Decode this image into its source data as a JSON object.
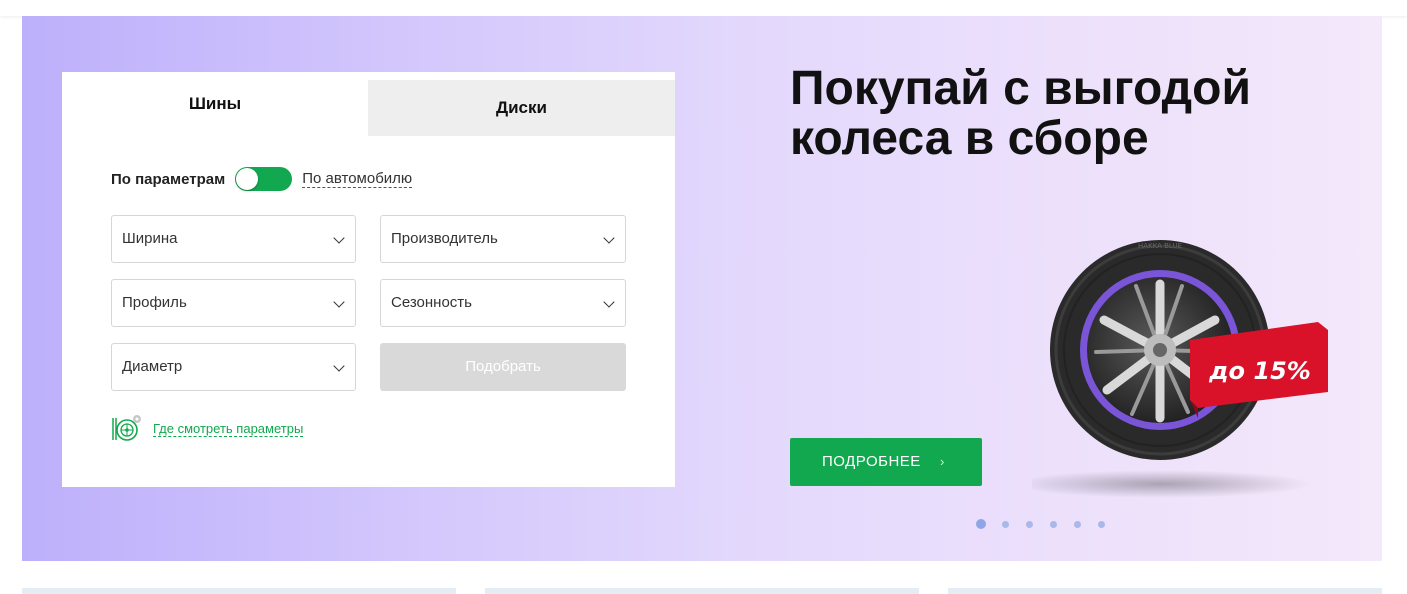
{
  "tabs": {
    "tires": "Шины",
    "wheels": "Диски"
  },
  "mode": {
    "by_params": "По параметрам",
    "by_car": "По автомобилю"
  },
  "selects": {
    "width": "Ширина",
    "manufacturer": "Производитель",
    "profile": "Профиль",
    "season": "Сезонность",
    "diameter": "Диаметр"
  },
  "submit_label": "Подобрать",
  "help_link": "Где смотреть параметры",
  "promo": {
    "headline_line1": "Покупай с выгодой",
    "headline_line2": "колеса в сборе",
    "badge": "до 15%",
    "tire_brand": "HAKKA BLUE",
    "more_label": "ПОДРОБНЕЕ",
    "more_arrow": "›"
  },
  "carousel": {
    "slide_count": 6,
    "active_index": 0
  },
  "colors": {
    "accent_green": "#12a84f",
    "banner_start": "#bdb0fb",
    "banner_end": "#f4e8fb",
    "badge_red": "#d9122a",
    "rim_purple": "#7a55d8",
    "button_disabled": "#d9d9d9"
  },
  "icons": {
    "help": "tire-params-icon",
    "toggle": "toggle-switch"
  }
}
